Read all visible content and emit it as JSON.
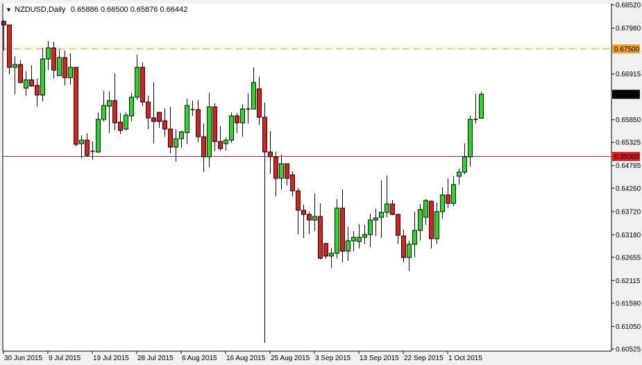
{
  "header": {
    "arrow": "▼",
    "symbol_timeframe": "NZDUSD,Daily",
    "ohlc_text": "0.65886 0.66500 0.65876 0.66442"
  },
  "colors": {
    "bull": "#22dd22",
    "bear": "#dd1f1f",
    "outline": "#000000",
    "resistance_line": "#f0a030",
    "support_line": "#dd1f1f",
    "current_price_bg": "#000000"
  },
  "chart_data": {
    "type": "candlestick",
    "title": "NZDUSD,Daily",
    "ylim": [
      0.60525,
      0.6852
    ],
    "y_ticks": [
      "0.68520",
      "0.67980",
      "0.66915",
      "0.65850",
      "0.65325",
      "0.64785",
      "0.64260",
      "0.63720",
      "0.63180",
      "0.62655",
      "0.62115",
      "0.61590",
      "0.61050",
      "0.60525"
    ],
    "x_ticks": [
      {
        "bar": 0,
        "label": "30 Jun 2015"
      },
      {
        "bar": 8,
        "label": "9 Jul 2015"
      },
      {
        "bar": 16,
        "label": "19 Jul 2015"
      },
      {
        "bar": 24,
        "label": "28 Jul 2015"
      },
      {
        "bar": 32,
        "label": "6 Aug 2015"
      },
      {
        "bar": 40,
        "label": "16 Aug 2015"
      },
      {
        "bar": 48,
        "label": "25 Aug 2015"
      },
      {
        "bar": 56,
        "label": "3 Sep 2015"
      },
      {
        "bar": 64,
        "label": "13 Sep 2015"
      },
      {
        "bar": 72,
        "label": "22 Sep 2015"
      },
      {
        "bar": 80,
        "label": "1 Oct 2015"
      }
    ],
    "hlines": [
      {
        "price": 0.675,
        "label": "0.67500",
        "style": "dashed",
        "color": "#f0a030"
      },
      {
        "price": 0.65,
        "label": "0.65000",
        "style": "solid",
        "color": "#dd1f1f"
      }
    ],
    "current_price": {
      "price": 0.66442,
      "label": "0.66442"
    },
    "ohlc_fields": [
      "open",
      "high",
      "low",
      "close"
    ],
    "candles": [
      [
        0.68133,
        0.68166,
        0.67456,
        0.68053
      ],
      [
        0.68053,
        0.68053,
        0.66908,
        0.67069
      ],
      [
        0.67069,
        0.67327,
        0.66441,
        0.67134
      ],
      [
        0.67134,
        0.67231,
        0.66699,
        0.66715
      ],
      [
        0.66586,
        0.66973,
        0.66408,
        0.66779
      ],
      [
        0.66779,
        0.67118,
        0.66618,
        0.66634
      ],
      [
        0.6665,
        0.66811,
        0.66167,
        0.66425
      ],
      [
        0.66425,
        0.67521,
        0.6628,
        0.67263
      ],
      [
        0.67263,
        0.67682,
        0.67005,
        0.67521
      ],
      [
        0.67521,
        0.67666,
        0.66811,
        0.67005
      ],
      [
        0.66876,
        0.67489,
        0.66876,
        0.67295
      ],
      [
        0.67295,
        0.67456,
        0.6665,
        0.66828
      ],
      [
        0.66828,
        0.67392,
        0.66666,
        0.67069
      ],
      [
        0.67069,
        0.67069,
        0.65232,
        0.6528
      ],
      [
        0.65296,
        0.6549,
        0.64958,
        0.65377
      ],
      [
        0.65377,
        0.65538,
        0.6499,
        0.65022
      ],
      [
        0.65119,
        0.65345,
        0.64925,
        0.65119
      ],
      [
        0.65103,
        0.66022,
        0.65087,
        0.6586
      ],
      [
        0.6586,
        0.66521,
        0.65812,
        0.66183
      ],
      [
        0.66167,
        0.66505,
        0.65538,
        0.66296
      ],
      [
        0.66296,
        0.66924,
        0.65602,
        0.6578
      ],
      [
        0.65796,
        0.66005,
        0.65522,
        0.65602
      ],
      [
        0.65635,
        0.66022,
        0.65602,
        0.65957
      ],
      [
        0.65941,
        0.66473,
        0.65812,
        0.66376
      ],
      [
        0.66376,
        0.67359,
        0.66312,
        0.67069
      ],
      [
        0.67069,
        0.67182,
        0.66167,
        0.66263
      ],
      [
        0.66263,
        0.66408,
        0.65635,
        0.65893
      ],
      [
        0.65893,
        0.66715,
        0.65296,
        0.65812
      ],
      [
        0.66022,
        0.66022,
        0.65667,
        0.65812
      ],
      [
        0.65828,
        0.66118,
        0.65457,
        0.65635
      ],
      [
        0.65635,
        0.6615,
        0.65071,
        0.65216
      ],
      [
        0.65216,
        0.65635,
        0.64877,
        0.65409
      ],
      [
        0.65409,
        0.65602,
        0.65199,
        0.6557
      ],
      [
        0.65554,
        0.66344,
        0.6528,
        0.66183
      ],
      [
        0.66086,
        0.66296,
        0.65941,
        0.66086
      ],
      [
        0.66086,
        0.66312,
        0.65328,
        0.65457
      ],
      [
        0.65457,
        0.65764,
        0.64635,
        0.6499
      ],
      [
        0.6499,
        0.66473,
        0.64748,
        0.6615
      ],
      [
        0.6615,
        0.66231,
        0.65119,
        0.65345
      ],
      [
        0.65345,
        0.65699,
        0.65135,
        0.65183
      ],
      [
        0.65296,
        0.65441,
        0.65135,
        0.65377
      ],
      [
        0.65377,
        0.66022,
        0.65312,
        0.65941
      ],
      [
        0.65941,
        0.66005,
        0.65538,
        0.6578
      ],
      [
        0.6578,
        0.66215,
        0.65457,
        0.66102
      ],
      [
        0.66102,
        0.66457,
        0.65764,
        0.66102
      ],
      [
        0.66102,
        0.67069,
        0.66102,
        0.66715
      ],
      [
        0.6657,
        0.66844,
        0.65731,
        0.65909
      ],
      [
        0.65909,
        0.66247,
        0.6067,
        0.65103
      ],
      [
        0.65103,
        0.65586,
        0.64603,
        0.6499
      ],
      [
        0.6499,
        0.65103,
        0.64071,
        0.6449
      ],
      [
        0.6449,
        0.65038,
        0.64232,
        0.64829
      ],
      [
        0.64829,
        0.64829,
        0.64329,
        0.6449
      ],
      [
        0.64571,
        0.64651,
        0.64071,
        0.642
      ],
      [
        0.642,
        0.64265,
        0.63184,
        0.63749
      ],
      [
        0.63749,
        0.63878,
        0.63104,
        0.63652
      ],
      [
        0.63652,
        0.63716,
        0.63201,
        0.63523
      ],
      [
        0.63523,
        0.64136,
        0.63265,
        0.63604
      ],
      [
        0.63604,
        0.6391,
        0.62604,
        0.62636
      ],
      [
        0.62975,
        0.62991,
        0.6262,
        0.62685
      ],
      [
        0.62685,
        0.62862,
        0.6241,
        0.62749
      ],
      [
        0.62749,
        0.64007,
        0.62636,
        0.63797
      ],
      [
        0.63797,
        0.64232,
        0.6254,
        0.62798
      ],
      [
        0.62798,
        0.63362,
        0.62572,
        0.63039
      ],
      [
        0.63039,
        0.63265,
        0.62798,
        0.6312
      ],
      [
        0.63023,
        0.63426,
        0.62862,
        0.6312
      ],
      [
        0.6312,
        0.6341,
        0.62959,
        0.63184
      ],
      [
        0.63184,
        0.63668,
        0.62894,
        0.63523
      ],
      [
        0.63523,
        0.63781,
        0.63152,
        0.63571
      ],
      [
        0.63587,
        0.64442,
        0.63104,
        0.637
      ],
      [
        0.637,
        0.64555,
        0.63587,
        0.63894
      ],
      [
        0.63894,
        0.6399,
        0.63636,
        0.63652
      ],
      [
        0.63652,
        0.63668,
        0.62959,
        0.63168
      ],
      [
        0.63152,
        0.63297,
        0.6254,
        0.62652
      ],
      [
        0.62652,
        0.63039,
        0.62346,
        0.62959
      ],
      [
        0.62959,
        0.63716,
        0.62652,
        0.63281
      ],
      [
        0.63281,
        0.63894,
        0.63056,
        0.63765
      ],
      [
        0.63587,
        0.64007,
        0.6341,
        0.63974
      ],
      [
        0.63958,
        0.63974,
        0.62862,
        0.63088
      ],
      [
        0.63088,
        0.63926,
        0.62959,
        0.63716
      ],
      [
        0.63716,
        0.64281,
        0.63555,
        0.64103
      ],
      [
        0.64103,
        0.6449,
        0.63797,
        0.6391
      ],
      [
        0.6391,
        0.64539,
        0.63845,
        0.64345
      ],
      [
        0.64539,
        0.64716,
        0.64345,
        0.64635
      ],
      [
        0.64635,
        0.65296,
        0.64587,
        0.6499
      ],
      [
        0.6499,
        0.65941,
        0.64764,
        0.6586
      ],
      [
        0.6586,
        0.66457,
        0.65764,
        0.6586
      ],
      [
        0.65886,
        0.665,
        0.65876,
        0.66442
      ]
    ]
  }
}
